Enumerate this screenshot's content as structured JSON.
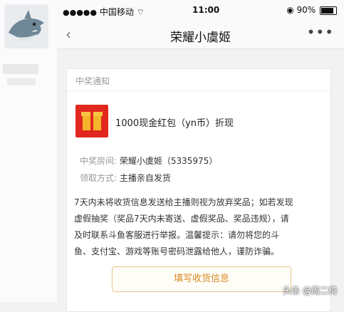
{
  "status_bar": {
    "signal": "●●●●●",
    "carrier": "中国移动",
    "wifi": "⌔",
    "time": "11:00",
    "battery_icon": "◉",
    "battery": "90%"
  },
  "nav": {
    "back_icon": "‹",
    "title": "荣耀小虞姬",
    "more_icon": "•••"
  },
  "card": {
    "title": "中奖通知",
    "prize": "1000现金红包（yn币）折现",
    "room_label": "中奖房间:",
    "room_value": "荣耀小虞姬（5335975）",
    "method_label": "领取方式:",
    "method_value": "主播亲自发货",
    "description_lines": [
      "7天内未将收货信息发送给主播则视为放弃奖品；如若发现",
      "虚假抽奖（奖品7天内未寄送、虚假奖品、奖品违规），请",
      "及时联系斗鱼客服进行举报。温馨提示：请勿将您的斗",
      "鱼、支付宝、游戏等账号密码泄露给他人，谨防诈骗。"
    ],
    "button_label": "填写收货信息"
  },
  "watermark": "头条 @周二椅"
}
